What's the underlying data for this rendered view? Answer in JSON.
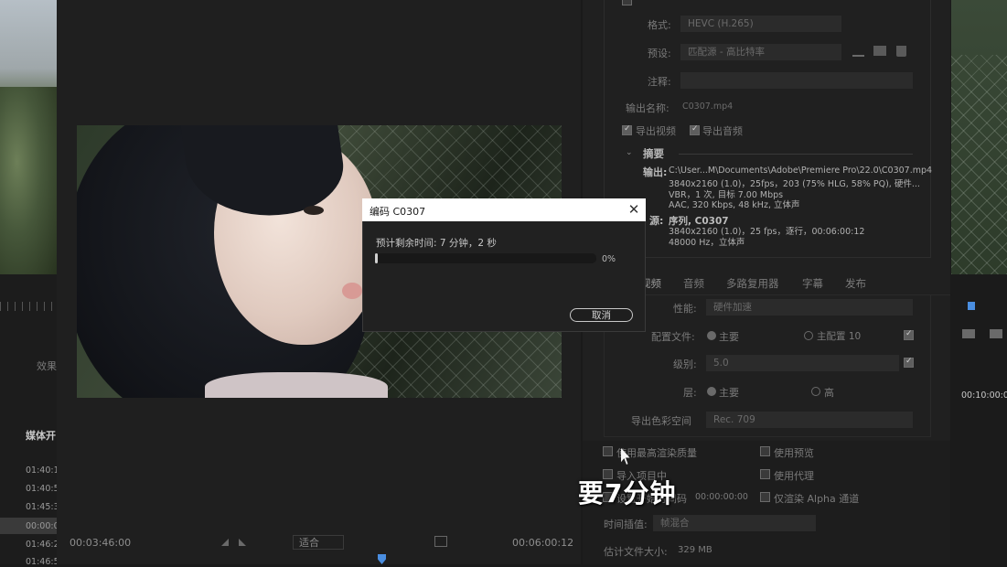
{
  "left_panel": {
    "effects_label": "效果",
    "media_label": "媒体开",
    "timestamps": [
      "01:40:10",
      "01:40:58",
      "01:45:32",
      "00:00:00",
      "01:46:28",
      "01:46:51"
    ]
  },
  "preview": {
    "timecode_in": "00:03:46:00",
    "timecode_out": "00:06:00:12",
    "fit_label": "适合"
  },
  "settings": {
    "format_label": "格式:",
    "format_value": "HEVC (H.265)",
    "preset_label": "预设:",
    "preset_value": "匹配源 - 高比特率",
    "comment_label": "注释:",
    "output_name_label": "输出名称:",
    "output_name_value": "C0307.mp4",
    "export_video": "导出视频",
    "export_audio": "导出音频",
    "summary_title": "摘要",
    "summary_output_key": "输出:",
    "summary_output_lines": [
      "C:\\User...M\\Documents\\Adobe\\Premiere Pro\\22.0\\C0307.mp4",
      "3840x2160 (1.0)，25fps，203 (75% HLG, 58% PQ), 硬件...",
      "VBR，1 次, 目标 7.00 Mbps",
      "AAC, 320 Kbps, 48 kHz, 立体声"
    ],
    "summary_source_key": "源:",
    "summary_source_lines": [
      "序列, C0307",
      "3840x2160 (1.0)，25 fps，逐行，00:06:00:12",
      "48000 Hz，立体声"
    ],
    "tabs": [
      "视频",
      "音频",
      "多路复用器",
      "字幕",
      "发布"
    ],
    "performance_label": "性能:",
    "performance_value": "硬件加速",
    "profile_label": "配置文件:",
    "profile_main": "主要",
    "profile_main10": "主配置 10",
    "level_label": "级别:",
    "level_value": "5.0",
    "tier_label": "层:",
    "tier_main": "主要",
    "tier_high": "高",
    "colorspace_label": "导出色彩空间",
    "colorspace_value": "Rec. 709"
  },
  "bottom_options": {
    "max_render_quality": "使用最高渲染质量",
    "use_preview": "使用预览",
    "import_project": "导入项目中",
    "use_proxy": "使用代理",
    "start_timecode_label": "设置开始时间码",
    "start_timecode_value": "00:00:00:00",
    "alpha_only": "仅渲染 Alpha 通道",
    "time_interp_label": "时间插值:",
    "time_interp_value": "帧混合",
    "file_size_label": "估计文件大小:",
    "file_size_value": "329 MB"
  },
  "right_panel": {
    "timecode": "00:10:00:00"
  },
  "dialog": {
    "title": "编码 C0307",
    "remaining": "预计剩余时间: 7 分钟，2 秒",
    "progress": 0.01,
    "percent": "0%",
    "cancel": "取消"
  },
  "subtitle": "要7分钟"
}
